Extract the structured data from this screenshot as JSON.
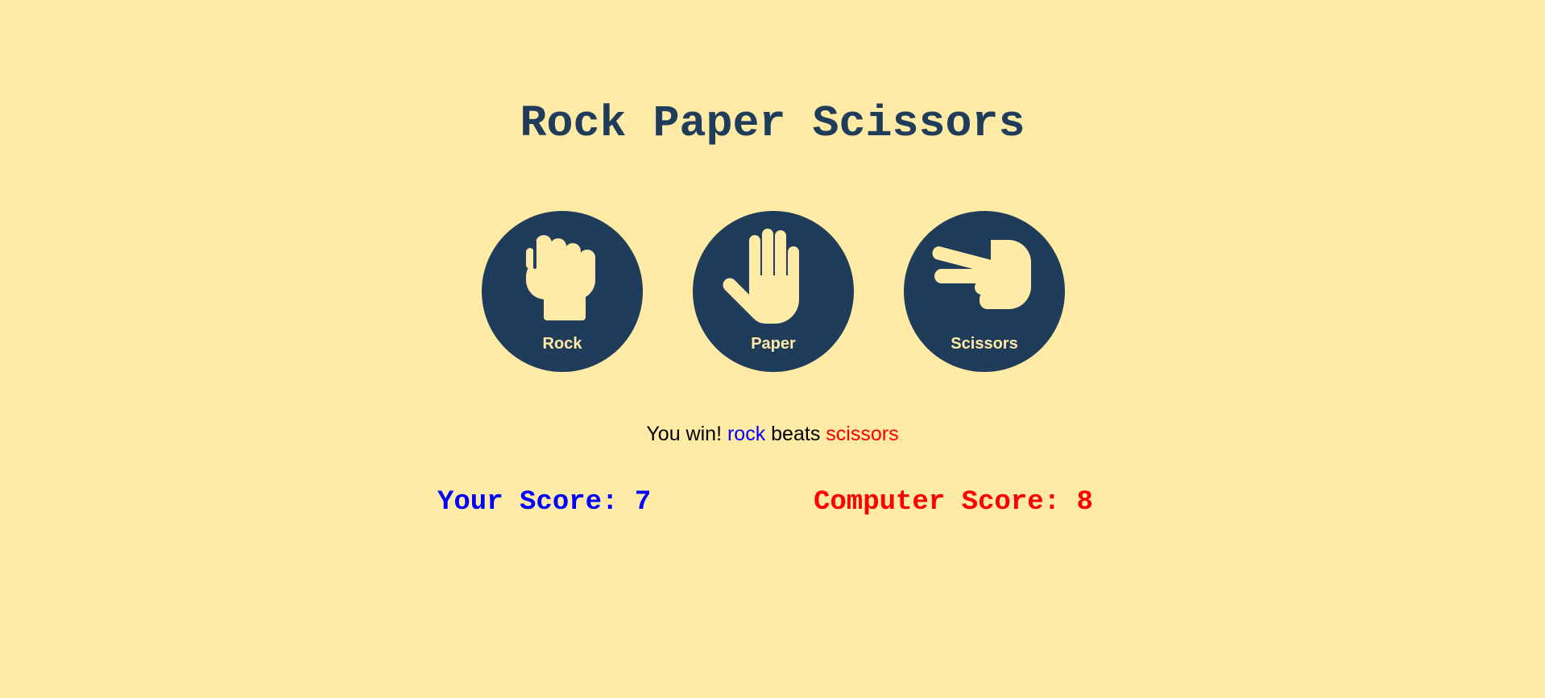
{
  "title": "Rock Paper Scissors",
  "choices": [
    {
      "label": "Rock",
      "icon": "fist-icon"
    },
    {
      "label": "Paper",
      "icon": "open-hand-icon"
    },
    {
      "label": "Scissors",
      "icon": "scissors-hand-icon"
    }
  ],
  "result": {
    "prefix": "You win!",
    "player_choice": "rock",
    "verb": "beats",
    "computer_choice": "scissors"
  },
  "scores": {
    "player_label": "Your Score: ",
    "player_value": "7",
    "computer_label": "Computer Score: ",
    "computer_value": "8"
  },
  "colors": {
    "background": "#ffeaa6",
    "accent": "#1f3c5a",
    "player": "#0000ff",
    "computer": "#ff0000"
  }
}
